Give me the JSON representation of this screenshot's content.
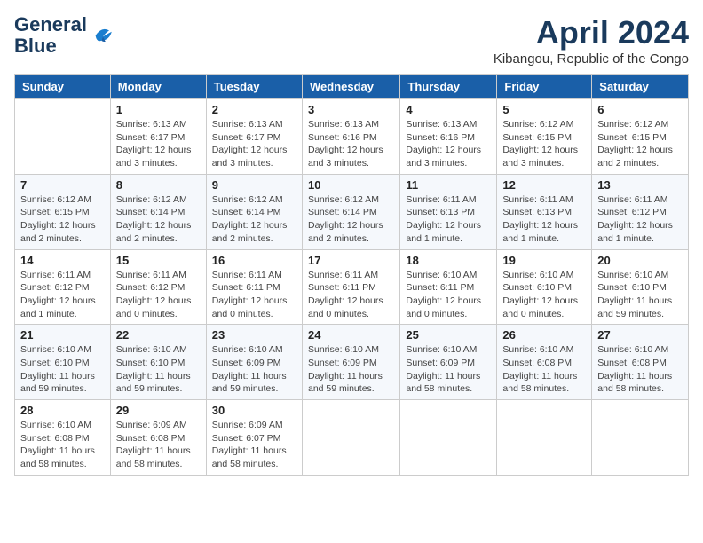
{
  "logo": {
    "line1": "General",
    "line2": "Blue"
  },
  "title": "April 2024",
  "subtitle": "Kibangou, Republic of the Congo",
  "weekdays": [
    "Sunday",
    "Monday",
    "Tuesday",
    "Wednesday",
    "Thursday",
    "Friday",
    "Saturday"
  ],
  "weeks": [
    [
      {
        "day": "",
        "info": ""
      },
      {
        "day": "1",
        "info": "Sunrise: 6:13 AM\nSunset: 6:17 PM\nDaylight: 12 hours\nand 3 minutes."
      },
      {
        "day": "2",
        "info": "Sunrise: 6:13 AM\nSunset: 6:17 PM\nDaylight: 12 hours\nand 3 minutes."
      },
      {
        "day": "3",
        "info": "Sunrise: 6:13 AM\nSunset: 6:16 PM\nDaylight: 12 hours\nand 3 minutes."
      },
      {
        "day": "4",
        "info": "Sunrise: 6:13 AM\nSunset: 6:16 PM\nDaylight: 12 hours\nand 3 minutes."
      },
      {
        "day": "5",
        "info": "Sunrise: 6:12 AM\nSunset: 6:15 PM\nDaylight: 12 hours\nand 3 minutes."
      },
      {
        "day": "6",
        "info": "Sunrise: 6:12 AM\nSunset: 6:15 PM\nDaylight: 12 hours\nand 2 minutes."
      }
    ],
    [
      {
        "day": "7",
        "info": "Sunrise: 6:12 AM\nSunset: 6:15 PM\nDaylight: 12 hours\nand 2 minutes."
      },
      {
        "day": "8",
        "info": "Sunrise: 6:12 AM\nSunset: 6:14 PM\nDaylight: 12 hours\nand 2 minutes."
      },
      {
        "day": "9",
        "info": "Sunrise: 6:12 AM\nSunset: 6:14 PM\nDaylight: 12 hours\nand 2 minutes."
      },
      {
        "day": "10",
        "info": "Sunrise: 6:12 AM\nSunset: 6:14 PM\nDaylight: 12 hours\nand 2 minutes."
      },
      {
        "day": "11",
        "info": "Sunrise: 6:11 AM\nSunset: 6:13 PM\nDaylight: 12 hours\nand 1 minute."
      },
      {
        "day": "12",
        "info": "Sunrise: 6:11 AM\nSunset: 6:13 PM\nDaylight: 12 hours\nand 1 minute."
      },
      {
        "day": "13",
        "info": "Sunrise: 6:11 AM\nSunset: 6:12 PM\nDaylight: 12 hours\nand 1 minute."
      }
    ],
    [
      {
        "day": "14",
        "info": "Sunrise: 6:11 AM\nSunset: 6:12 PM\nDaylight: 12 hours\nand 1 minute."
      },
      {
        "day": "15",
        "info": "Sunrise: 6:11 AM\nSunset: 6:12 PM\nDaylight: 12 hours\nand 0 minutes."
      },
      {
        "day": "16",
        "info": "Sunrise: 6:11 AM\nSunset: 6:11 PM\nDaylight: 12 hours\nand 0 minutes."
      },
      {
        "day": "17",
        "info": "Sunrise: 6:11 AM\nSunset: 6:11 PM\nDaylight: 12 hours\nand 0 minutes."
      },
      {
        "day": "18",
        "info": "Sunrise: 6:10 AM\nSunset: 6:11 PM\nDaylight: 12 hours\nand 0 minutes."
      },
      {
        "day": "19",
        "info": "Sunrise: 6:10 AM\nSunset: 6:10 PM\nDaylight: 12 hours\nand 0 minutes."
      },
      {
        "day": "20",
        "info": "Sunrise: 6:10 AM\nSunset: 6:10 PM\nDaylight: 11 hours\nand 59 minutes."
      }
    ],
    [
      {
        "day": "21",
        "info": "Sunrise: 6:10 AM\nSunset: 6:10 PM\nDaylight: 11 hours\nand 59 minutes."
      },
      {
        "day": "22",
        "info": "Sunrise: 6:10 AM\nSunset: 6:10 PM\nDaylight: 11 hours\nand 59 minutes."
      },
      {
        "day": "23",
        "info": "Sunrise: 6:10 AM\nSunset: 6:09 PM\nDaylight: 11 hours\nand 59 minutes."
      },
      {
        "day": "24",
        "info": "Sunrise: 6:10 AM\nSunset: 6:09 PM\nDaylight: 11 hours\nand 59 minutes."
      },
      {
        "day": "25",
        "info": "Sunrise: 6:10 AM\nSunset: 6:09 PM\nDaylight: 11 hours\nand 58 minutes."
      },
      {
        "day": "26",
        "info": "Sunrise: 6:10 AM\nSunset: 6:08 PM\nDaylight: 11 hours\nand 58 minutes."
      },
      {
        "day": "27",
        "info": "Sunrise: 6:10 AM\nSunset: 6:08 PM\nDaylight: 11 hours\nand 58 minutes."
      }
    ],
    [
      {
        "day": "28",
        "info": "Sunrise: 6:10 AM\nSunset: 6:08 PM\nDaylight: 11 hours\nand 58 minutes."
      },
      {
        "day": "29",
        "info": "Sunrise: 6:09 AM\nSunset: 6:08 PM\nDaylight: 11 hours\nand 58 minutes."
      },
      {
        "day": "30",
        "info": "Sunrise: 6:09 AM\nSunset: 6:07 PM\nDaylight: 11 hours\nand 58 minutes."
      },
      {
        "day": "",
        "info": ""
      },
      {
        "day": "",
        "info": ""
      },
      {
        "day": "",
        "info": ""
      },
      {
        "day": "",
        "info": ""
      }
    ]
  ]
}
